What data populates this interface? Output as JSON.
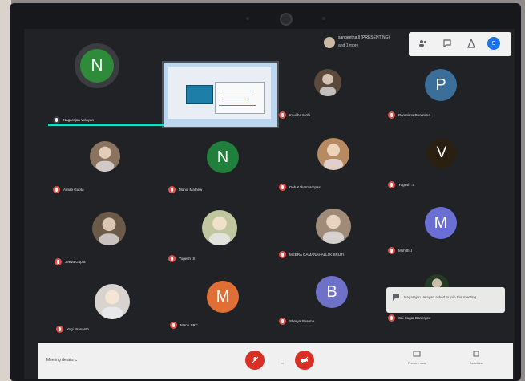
{
  "app": "Google Meet",
  "presenter": {
    "name": "sangeetha.ll (PRESENTING)",
    "subtitle": "and 1 more"
  },
  "toolbar": {
    "people_icon": "people-icon",
    "chat_icon": "chat-icon",
    "activities_icon": "activities-icon",
    "self_avatar_letter": "S"
  },
  "tiles": [
    {
      "name": "Nagarajan Velayan",
      "letter": "N",
      "color": "#2e8b3a"
    },
    {
      "name": "Kavitha Mohi",
      "letter": "",
      "color": "#5b4a3c"
    },
    {
      "name": "Poornima Poornima",
      "letter": "P",
      "color": "#3b6e99"
    },
    {
      "name": "Arnab Gupta",
      "letter": "",
      "color": "#8a7460"
    },
    {
      "name": "Manoj Mathew",
      "letter": "N",
      "color": "#1f7f3b"
    },
    {
      "name": "Deb Kakarmarhpas",
      "letter": "",
      "color": "#b78a62"
    },
    {
      "name": "Yogesh .S",
      "letter": "V",
      "color": "#2a2012"
    },
    {
      "name": "Jeeva Gupta",
      "letter": "",
      "color": "#6c5a48"
    },
    {
      "name": "Yogesh .S",
      "letter": "",
      "color": "#c0c7a0"
    },
    {
      "name": "MEERA GAMANAHALLI K SRUTI",
      "letter": "",
      "color": "#9f8b77"
    },
    {
      "name": "Mohith .I",
      "letter": "M",
      "color": "#6a6fd6"
    },
    {
      "name": "Yogi Prasanth",
      "letter": "",
      "color": "#d7d3cf"
    },
    {
      "name": "Manu SRC",
      "letter": "M",
      "color": "#e06f35"
    },
    {
      "name": "Shreya Sharma",
      "letter": "B",
      "color": "#6f71c9"
    },
    {
      "name": "Sai Sagar Banergee",
      "letter": "",
      "color": "#243b25"
    }
  ],
  "notification": {
    "text": "Nagarajan Velayan asked to join this meeting"
  },
  "bottom": {
    "meeting_details": "Meeting details ⌄",
    "leave_icon_label": "✆",
    "center_label": "•••",
    "present_now": "Present now",
    "activities": "Activities"
  }
}
